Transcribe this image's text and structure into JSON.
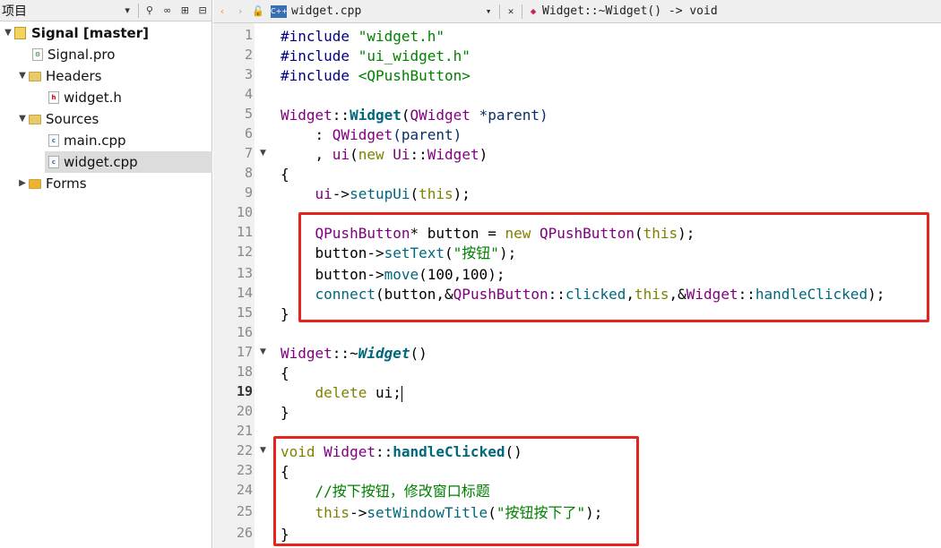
{
  "project_panel": {
    "title": "项目",
    "tree": [
      {
        "label": "Signal [master]",
        "type": "project"
      },
      {
        "label": "Signal.pro",
        "type": "pro-file"
      },
      {
        "label": "Headers",
        "type": "folder"
      },
      {
        "label": "widget.h",
        "type": "header-file"
      },
      {
        "label": "Sources",
        "type": "folder"
      },
      {
        "label": "main.cpp",
        "type": "cpp-file"
      },
      {
        "label": "widget.cpp",
        "type": "cpp-file",
        "selected": true
      },
      {
        "label": "Forms",
        "type": "folder"
      }
    ]
  },
  "editor": {
    "file_tab": "widget.cpp",
    "symbol": "Widget::~Widget() -> void",
    "current_line": 19,
    "line_numbers": [
      "1",
      "2",
      "3",
      "4",
      "5",
      "6",
      "7",
      "8",
      "9",
      "10",
      "11",
      "12",
      "13",
      "14",
      "15",
      "16",
      "17",
      "18",
      "19",
      "20",
      "21",
      "22",
      "23",
      "24",
      "25",
      "26"
    ],
    "code": {
      "l1_a": "#include ",
      "l1_b": "\"widget.h\"",
      "l2_a": "#include ",
      "l2_b": "\"ui_widget.h\"",
      "l3_a": "#include ",
      "l3_b": "<QPushButton>",
      "l5_a": "Widget",
      "l5_b": "::",
      "l5_c": "Widget",
      "l5_d": "(",
      "l5_e": "QWidget",
      "l5_f": " *parent)",
      "l6_a": "    : ",
      "l6_b": "QWidget",
      "l6_c": "(parent)",
      "l7_a": "    , ",
      "l7_b": "ui",
      "l7_c": "(",
      "l7_d": "new",
      "l7_e": " Ui",
      "l7_f": "::",
      "l7_g": "Widget",
      "l7_h": ")",
      "l8": "{",
      "l9_a": "    ui",
      "l9_b": "->",
      "l9_c": "setupUi",
      "l9_d": "(",
      "l9_e": "this",
      "l9_f": ");",
      "l11_a": "    QPushButton",
      "l11_b": "* button = ",
      "l11_c": "new",
      "l11_d": " QPushButton",
      "l11_e": "(",
      "l11_f": "this",
      "l11_g": ");",
      "l12_a": "    button",
      "l12_b": "->",
      "l12_c": "setText",
      "l12_d": "(",
      "l12_e": "\"按钮\"",
      "l12_f": ");",
      "l13_a": "    button",
      "l13_b": "->",
      "l13_c": "move",
      "l13_d": "(100,100);",
      "l14_a": "    ",
      "l14_b": "connect",
      "l14_c": "(button,&",
      "l14_d": "QPushButton",
      "l14_e": "::",
      "l14_f": "clicked",
      "l14_g": ",",
      "l14_h": "this",
      "l14_i": ",&",
      "l14_j": "Widget",
      "l14_k": "::",
      "l14_l": "handleClicked",
      "l14_m": ");",
      "l15": "}",
      "l17_a": "Widget",
      "l17_b": "::~",
      "l17_c": "Widget",
      "l17_d": "()",
      "l18": "{",
      "l19_a": "    ",
      "l19_b": "delete",
      "l19_c": " ui;",
      "l20": "}",
      "l22_a": "void",
      "l22_b": " Widget",
      "l22_c": "::",
      "l22_d": "handleClicked",
      "l22_e": "()",
      "l23": "{",
      "l24": "    //按下按钮，修改窗口标题",
      "l25_a": "    ",
      "l25_b": "this",
      "l25_c": "->",
      "l25_d": "setWindowTitle",
      "l25_e": "(",
      "l25_f": "\"按钮按下了\"",
      "l25_g": ");",
      "l26": "}"
    }
  },
  "colors": {
    "highlight_box": "#e8231f",
    "change_marker": "#3da53d"
  }
}
